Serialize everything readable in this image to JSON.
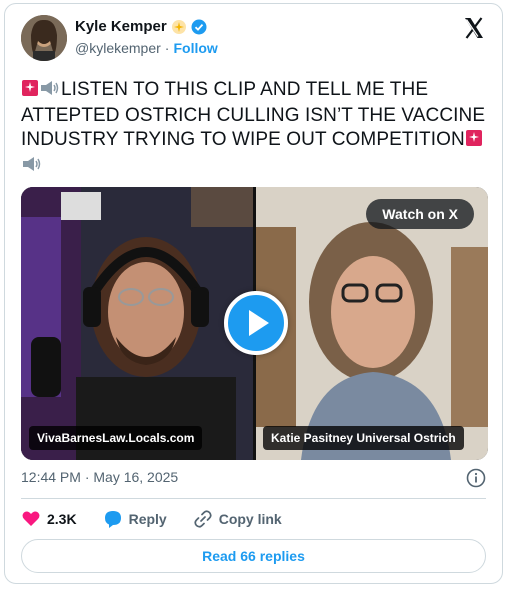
{
  "author": {
    "name": "Kyle Kemper",
    "handle": "@kylekemper",
    "separator": "·",
    "follow_label": "Follow"
  },
  "tweet": {
    "text": "LISTEN TO THIS CLIP AND TELL ME THE ATTEPTED OSTRICH CULLING ISN’T THE VACCINE INDUSTRY TRYING TO WIPE OUT COMPETITION",
    "timestamp": "12:44 PM · May 16, 2025"
  },
  "media": {
    "watch_label": "Watch on X",
    "left_caption": "VivaBarnesLaw.Locals.com",
    "right_caption": "Katie Pasitney Universal Ostrich"
  },
  "actions": {
    "likes": "2.3K",
    "reply_label": "Reply",
    "copy_label": "Copy link"
  },
  "read_replies_label": "Read 66 replies",
  "colors": {
    "accent": "#1d9bf0",
    "like": "#f91880",
    "muted": "#536471"
  }
}
